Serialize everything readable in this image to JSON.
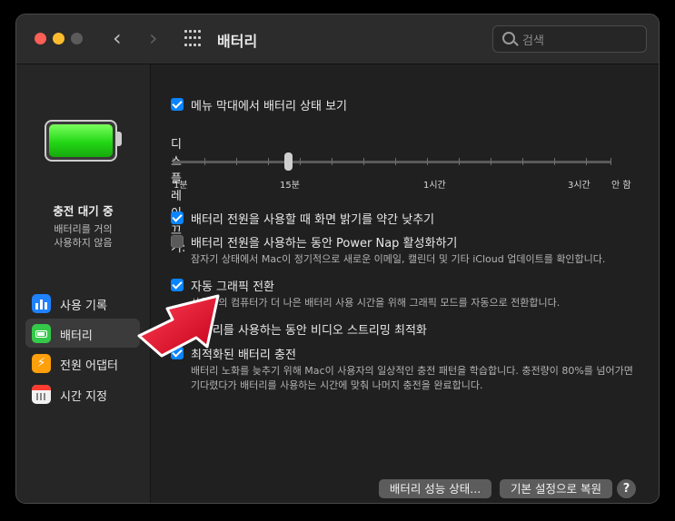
{
  "window": {
    "title": "배터리"
  },
  "search": {
    "placeholder": "검색"
  },
  "nav": {
    "back": "‹",
    "forward": "›"
  },
  "battery_status": {
    "title": "충전 대기 중",
    "subtitle_line1": "배터리를 거의",
    "subtitle_line2": "사용하지 않음",
    "level_fraction": 1.0
  },
  "sidebar": {
    "items": [
      {
        "label": "사용 기록",
        "icon": "bar-chart-icon",
        "selected": false
      },
      {
        "label": "배터리",
        "icon": "battery-icon",
        "selected": true
      },
      {
        "label": "전원 어댑터",
        "icon": "lightning-icon",
        "selected": false
      },
      {
        "label": "시간 지정",
        "icon": "calendar-icon",
        "selected": false
      }
    ]
  },
  "settings": {
    "show_in_menubar": {
      "label": "메뉴 막대에서 배터리 상태 보기",
      "checked": true
    },
    "display_off": {
      "label": "디스플레이 끄기:",
      "ticks": [
        "1분",
        "15분",
        "1시간",
        "3시간",
        "안 함"
      ],
      "value": "15분"
    },
    "dim_display": {
      "label": "배터리 전원을 사용할 때 화면 밝기를 약간 낮추기",
      "checked": true
    },
    "power_nap": {
      "label": "배터리 전원을 사용하는 동안 Power Nap 활성화하기",
      "checked": false,
      "desc": "잠자기 상태에서 Mac이 정기적으로 새로운 이메일, 캘린더 및 기타 iCloud 업데이트를 확인합니다."
    },
    "auto_graphics": {
      "label": "자동 그래픽 전환",
      "checked": true,
      "desc": "사용자의 컴퓨터가 더 나은 배터리 사용 시간을 위해 그래픽 모드를 자동으로 전환합니다."
    },
    "video_streaming": {
      "label": "배터리를 사용하는 동안 비디오 스트리밍 최적화",
      "checked": true
    },
    "optimized_charging": {
      "label": "최적화된 배터리 충전",
      "checked": true,
      "desc_line1": "배터리 노화를 늦추기 위해 Mac이 사용자의 일상적인 충전 패턴을 학습합니다. 충전량이 80%를 넘어가면",
      "desc_line2": "기다렸다가 배터리를 사용하는 시간에 맞춰 나머지 충전을 완료합니다."
    }
  },
  "buttons": {
    "battery_health": "배터리 성능 상태...",
    "restore_defaults": "기본 설정으로 복원",
    "help": "?"
  },
  "colors": {
    "accent": "#0a84ff",
    "annotation_arrow": "#e8001c",
    "battery_green": "#23d716"
  }
}
